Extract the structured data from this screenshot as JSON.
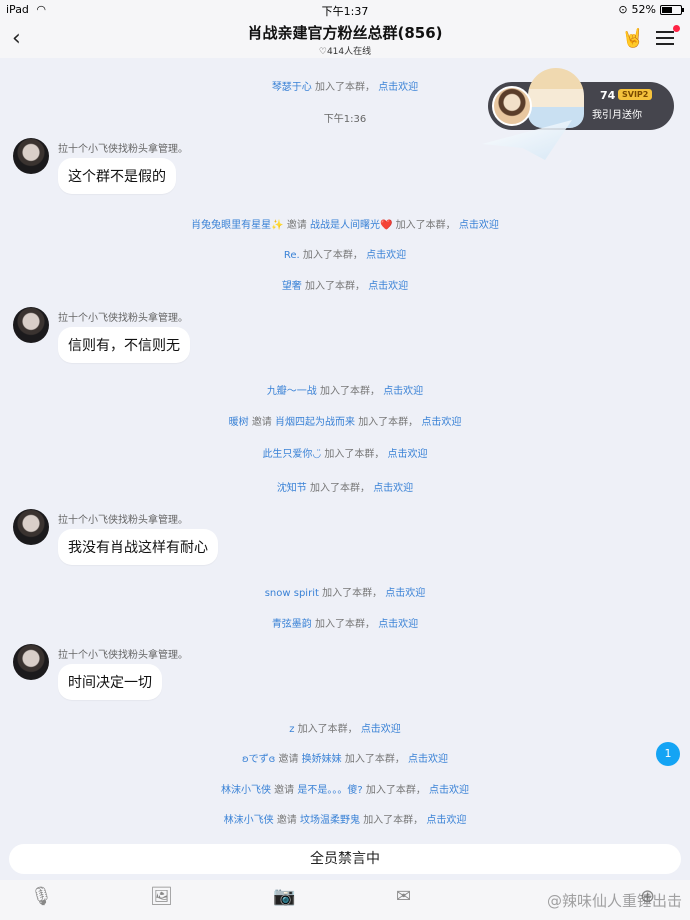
{
  "status_bar": {
    "device": "iPad",
    "time": "下午1:37",
    "battery": "52%",
    "battery_level": 0.52
  },
  "header": {
    "title": "肖战亲建官方粉丝总群(856)",
    "online": "414人在线"
  },
  "gift": {
    "count": "74",
    "badge": "SVIP2",
    "text": "我引月送你"
  },
  "time_divider": "下午1:36",
  "sys_msgs": [
    {
      "name": "琴瑟于心",
      "action": "加入了本群，",
      "link": "点击欢迎"
    },
    {
      "name": "肖兔兔眼里有星星✨",
      "invite_label": "邀请",
      "invitee": "战战是人间曙光❤️",
      "action": "加入了本群，",
      "link": "点击欢迎"
    },
    {
      "name": "Re.",
      "action": "加入了本群，",
      "link": "点击欢迎"
    },
    {
      "name": "望奢",
      "action": "加入了本群，",
      "link": "点击欢迎"
    },
    {
      "name": "九瓣～一战",
      "action": "加入了本群，",
      "link": "点击欢迎"
    },
    {
      "name": "暖树",
      "invite_label": "邀请",
      "invitee": "肖烟四起为战而来",
      "action": "加入了本群，",
      "link": "点击欢迎"
    },
    {
      "name": "此生只爱你◡̈",
      "action": "加入了本群，",
      "link": "点击欢迎"
    },
    {
      "name": "沈知节",
      "action": "加入了本群，",
      "link": "点击欢迎"
    },
    {
      "name": "snow spirit",
      "action": "加入了本群，",
      "link": "点击欢迎"
    },
    {
      "name": "青弦墨韵",
      "action": "加入了本群，",
      "link": "点击欢迎"
    },
    {
      "name": "z",
      "action": "加入了本群，",
      "link": "点击欢迎"
    },
    {
      "name": "ʚでずɞ",
      "invite_label": "邀请",
      "invitee": "换娇妹妹",
      "action": "加入了本群，",
      "link": "点击欢迎"
    },
    {
      "name": "林沫小飞侠",
      "invite_label": "邀请",
      "invitee": "是不是。。。傻?",
      "action": "加入了本群，",
      "link": "点击欢迎"
    },
    {
      "name": "林沫小飞侠",
      "invite_label": "邀请",
      "invitee": "坟场温柔野鬼",
      "action": "加入了本群，",
      "link": "点击欢迎"
    }
  ],
  "messages": [
    {
      "sender": "拉十个小飞侠找粉头拿管理。",
      "text": "这个群不是假的"
    },
    {
      "sender": "拉十个小飞侠找粉头拿管理。",
      "text": "信则有，不信则无"
    },
    {
      "sender": "拉十个小飞侠找粉头拿管理。",
      "text": "我没有肖战这样有耐心"
    },
    {
      "sender": "拉十个小飞侠找粉头拿管理。",
      "text": "时间决定一切"
    }
  ],
  "unread_count": "1",
  "mute_label": "全员禁言中",
  "watermark": "@辣味仙人重锤出击"
}
